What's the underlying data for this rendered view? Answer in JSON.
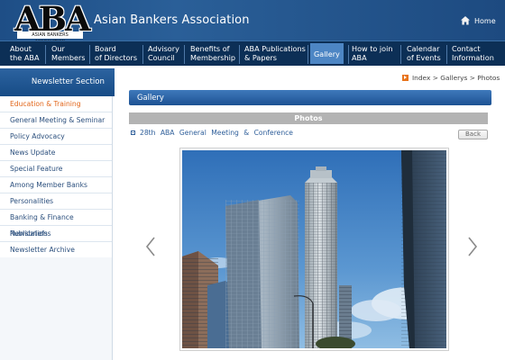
{
  "header": {
    "logo_text": "ABA",
    "logo_tagline": "ASIAN BANKERS ASSOCIATION",
    "site_title": "Asian Bankers Association",
    "home_label": "Home"
  },
  "nav": {
    "items": [
      {
        "line1": "About",
        "line2": "the ABA"
      },
      {
        "line1": "Our",
        "line2": "Members"
      },
      {
        "line1": "Board",
        "line2": "of Directors"
      },
      {
        "line1": "Advisory",
        "line2": "Council"
      },
      {
        "line1": "Benefits of",
        "line2": "Membership"
      },
      {
        "line1": "ABA Publications",
        "line2": "& Papers"
      },
      {
        "line1": "Gallery",
        "line2": ""
      },
      {
        "line1": "How to  join",
        "line2": "ABA"
      },
      {
        "line1": "Calendar",
        "line2": "of Events"
      },
      {
        "line1": "Contact",
        "line2": "Information"
      }
    ],
    "active": "Gallery"
  },
  "breadcrumb": {
    "text": "Index > Gallerys > Photos"
  },
  "sidebar": {
    "heading": "Newsletter Section",
    "items": [
      {
        "label": "Education & Training"
      },
      {
        "label": "General Meeting & Seminar"
      },
      {
        "label": "Policy Advocacy"
      },
      {
        "label": "News Update"
      },
      {
        "label": "Special Feature"
      },
      {
        "label": "Among Member Banks"
      },
      {
        "label": "Personalities"
      },
      {
        "label": "Banking & Finance Newsbriefs"
      },
      {
        "label": "Publications"
      },
      {
        "label": "Newsletter Archive"
      }
    ],
    "active_index": 0
  },
  "main": {
    "gallery_title": "Gallery",
    "photos_title": "Photos",
    "album_title": "28th  ABA General Meeting & Conference",
    "back_label": "Back",
    "prev_icon": "chevron-left-icon",
    "next_icon": "chevron-right-icon"
  },
  "colors": {
    "header_blue": "#1e4e86",
    "nav_navy": "#0c2f56",
    "active_tab": "#4d86c4",
    "sidebar_active": "#e2661a",
    "link_blue": "#2f5f9a"
  }
}
